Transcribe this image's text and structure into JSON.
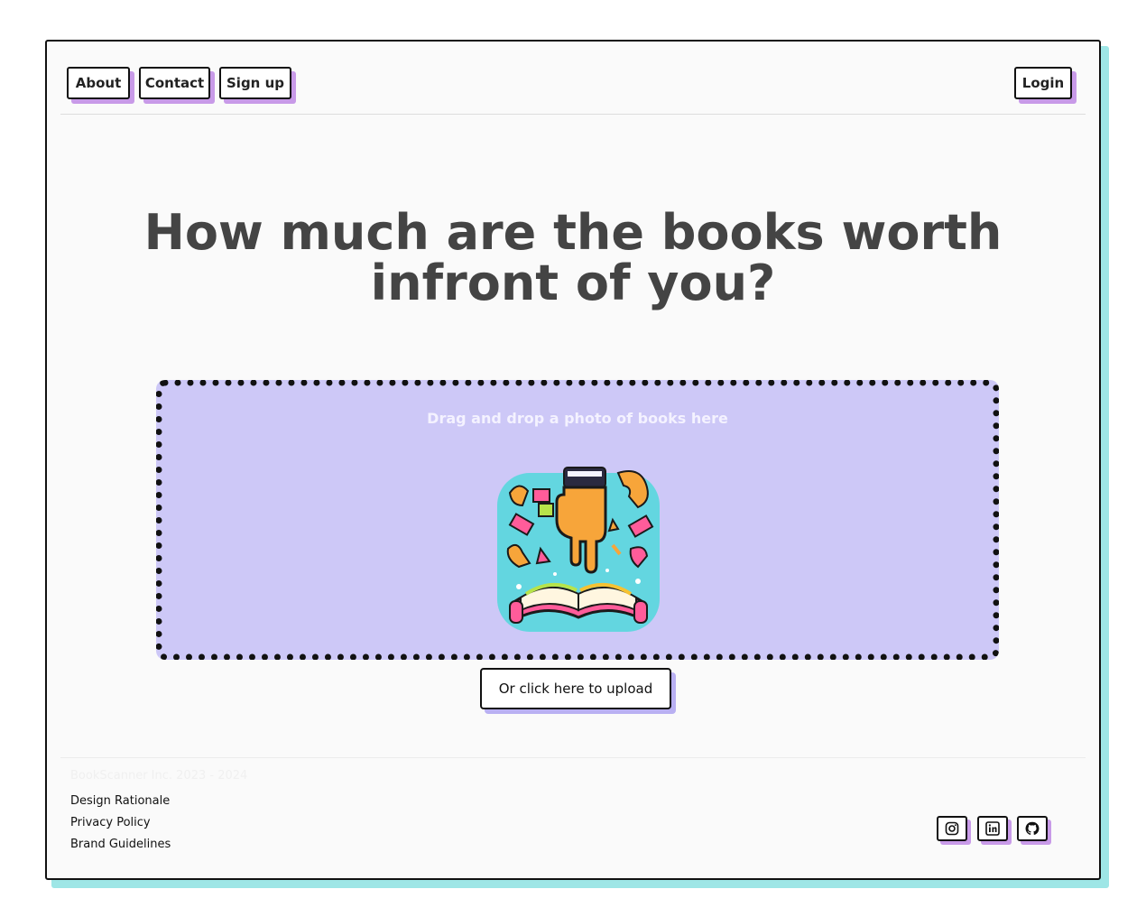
{
  "nav": {
    "about_label": "About",
    "contact_label": "Contact",
    "signup_label": "Sign up",
    "login_label": "Login"
  },
  "hero": {
    "title": "How much are the books worth infront of you?"
  },
  "upload": {
    "dropzone_label": "Drag and drop a photo of books here",
    "button_label": "Or click here to upload"
  },
  "footer": {
    "copyright": "BookScanner Inc. 2023 - 2024",
    "links": [
      "Design Rationale",
      "Privacy Policy",
      "Brand Guidelines"
    ],
    "social_icons": [
      "instagram-icon",
      "linkedin-icon",
      "github-icon"
    ]
  },
  "colors": {
    "accent_shadow": "#c89ae8",
    "dropzone_bg": "#cdc8f7",
    "frame_shadow": "#9ee6e6"
  }
}
